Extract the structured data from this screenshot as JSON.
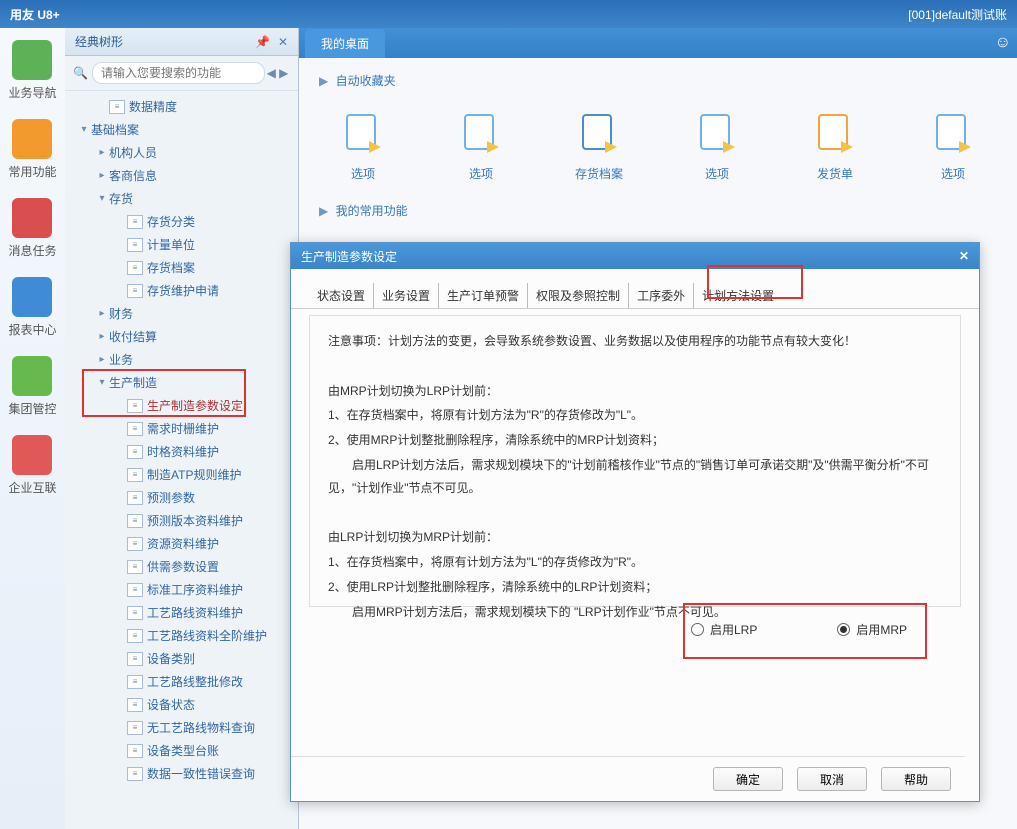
{
  "titlebar": {
    "product": "用友 U8+",
    "right": "[001]default测试账"
  },
  "leftbar": {
    "items": [
      {
        "label": "业务导航",
        "color": "#5fb157"
      },
      {
        "label": "常用功能",
        "color": "#f39a2e"
      },
      {
        "label": "消息任务",
        "color": "#d94f4f"
      },
      {
        "label": "报表中心",
        "color": "#3f8bd6"
      },
      {
        "label": "集团管控",
        "color": "#67b84e"
      },
      {
        "label": "企业互联",
        "color": "#e05858"
      }
    ]
  },
  "sidepanel": {
    "title": "经典树形",
    "search_placeholder": "请输入您要搜索的功能",
    "nodes": [
      {
        "indent": 1,
        "type": "leaf",
        "label": "数据精度"
      },
      {
        "indent": 0,
        "type": "open",
        "label": "基础档案"
      },
      {
        "indent": 1,
        "type": "closed",
        "label": "机构人员"
      },
      {
        "indent": 1,
        "type": "closed",
        "label": "客商信息"
      },
      {
        "indent": 1,
        "type": "open",
        "label": "存货"
      },
      {
        "indent": 2,
        "type": "leaf",
        "label": "存货分类"
      },
      {
        "indent": 2,
        "type": "leaf",
        "label": "计量单位"
      },
      {
        "indent": 2,
        "type": "leaf",
        "label": "存货档案"
      },
      {
        "indent": 2,
        "type": "leaf",
        "label": "存货维护申请"
      },
      {
        "indent": 1,
        "type": "closed",
        "label": "财务"
      },
      {
        "indent": 1,
        "type": "closed",
        "label": "收付结算"
      },
      {
        "indent": 1,
        "type": "closed",
        "label": "业务"
      },
      {
        "indent": 1,
        "type": "open",
        "label": "生产制造",
        "hl": "row"
      },
      {
        "indent": 2,
        "type": "leaf",
        "label": "生产制造参数设定",
        "hl": "sel"
      },
      {
        "indent": 2,
        "type": "leaf",
        "label": "需求时栅维护"
      },
      {
        "indent": 2,
        "type": "leaf",
        "label": "时格资料维护"
      },
      {
        "indent": 2,
        "type": "leaf",
        "label": "制造ATP规则维护"
      },
      {
        "indent": 2,
        "type": "leaf",
        "label": "预测参数"
      },
      {
        "indent": 2,
        "type": "leaf",
        "label": "预测版本资料维护"
      },
      {
        "indent": 2,
        "type": "leaf",
        "label": "资源资料维护"
      },
      {
        "indent": 2,
        "type": "leaf",
        "label": "供需参数设置"
      },
      {
        "indent": 2,
        "type": "leaf",
        "label": "标准工序资料维护"
      },
      {
        "indent": 2,
        "type": "leaf",
        "label": "工艺路线资料维护"
      },
      {
        "indent": 2,
        "type": "leaf",
        "label": "工艺路线资料全阶维护"
      },
      {
        "indent": 2,
        "type": "leaf",
        "label": "设备类别"
      },
      {
        "indent": 2,
        "type": "leaf",
        "label": "工艺路线整批修改"
      },
      {
        "indent": 2,
        "type": "leaf",
        "label": "设备状态"
      },
      {
        "indent": 2,
        "type": "leaf",
        "label": "无工艺路线物料查询"
      },
      {
        "indent": 2,
        "type": "leaf",
        "label": "设备类型台账"
      },
      {
        "indent": 2,
        "type": "leaf",
        "label": "数据一致性错误查询"
      }
    ]
  },
  "content": {
    "tab": "我的桌面",
    "fav_header": "自动收藏夹",
    "common_header": "我的常用功能",
    "shortcuts": [
      {
        "label": "选项"
      },
      {
        "label": "选项"
      },
      {
        "label": "存货档案"
      },
      {
        "label": "选项"
      },
      {
        "label": "发货单"
      },
      {
        "label": "选项"
      }
    ]
  },
  "dialog": {
    "title": "生产制造参数设定",
    "tabs": [
      "状态设置",
      "业务设置",
      "生产订单预警",
      "权限及参照控制",
      "工序委外",
      "计划方法设置"
    ],
    "active_tab": 5,
    "notice": "注意事项：计划方法的变更，会导致系统参数设置、业务数据以及使用程序的功能节点有较大变化！",
    "sec1_title": "由MRP计划切换为LRP计划前：",
    "sec1_l1": "1、在存货档案中，将原有计划方法为\"R\"的存货修改为\"L\"。",
    "sec1_l2": "2、使用MRP计划整批删除程序，清除系统中的MRP计划资料；",
    "sec1_l3": "启用LRP计划方法后，需求规划模块下的\"计划前稽核作业\"节点的\"销售订单可承诺交期\"及\"供需平衡分析\"不可见，\"计划作业\"节点不可见。",
    "sec2_title": "由LRP计划切换为MRP计划前：",
    "sec2_l1": "1、在存货档案中，将原有计划方法为\"L\"的存货修改为\"R\"。",
    "sec2_l2": "2、使用LRP计划整批删除程序，清除系统中的LRP计划资料；",
    "sec2_l3": "启用MRP计划方法后，需求规划模块下的 \"LRP计划作业\"节点不可见。",
    "radio_lrp": "启用LRP",
    "radio_mrp": "启用MRP",
    "btn_ok": "确定",
    "btn_cancel": "取消",
    "btn_help": "帮助"
  }
}
